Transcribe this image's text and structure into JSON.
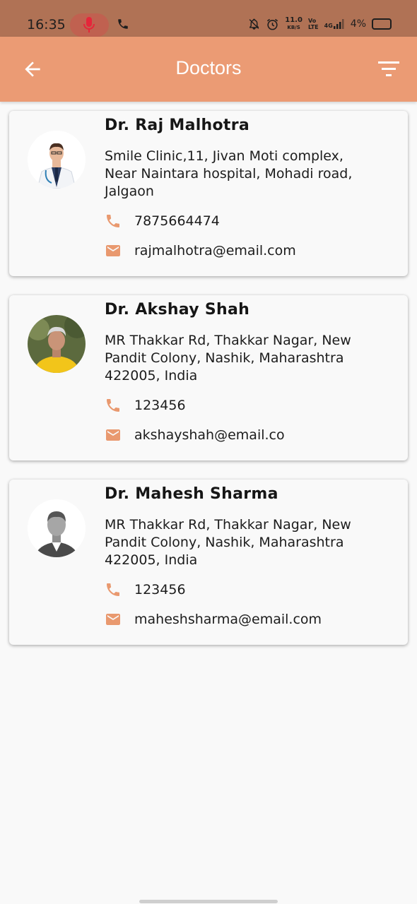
{
  "status_bar": {
    "time": "16:35",
    "net_speed_value": "11.0",
    "net_speed_unit": "KB/S",
    "volte_top": "Vo",
    "volte_bottom": "LTE",
    "network": "4G",
    "battery": "4%"
  },
  "app_bar": {
    "title": "Doctors",
    "back_icon": "arrow-left-icon",
    "filter_icon": "filter-icon"
  },
  "theme": {
    "accent": "#eb9b74",
    "status_bar": "#b07255",
    "icon_color": "#e9996f"
  },
  "doctors": [
    {
      "name": "Dr. Raj Malhotra",
      "address_lines": [
        "Smile Clinic,11, Jivan Moti complex,",
        "Near Naintara hospital, Mohadi road,",
        "Jalgaon"
      ],
      "phone": "7875664474",
      "email": "rajmalhotra@email.com"
    },
    {
      "name": "Dr. Akshay Shah",
      "address_lines": [
        "MR Thakkar Rd, Thakkar Nagar, New",
        "Pandit Colony, Nashik, Maharashtra",
        "422005, India"
      ],
      "phone": "123456",
      "email": "akshayshah@email.co"
    },
    {
      "name": "Dr. Mahesh Sharma",
      "address_lines": [
        "MR Thakkar Rd, Thakkar Nagar, New",
        "Pandit Colony, Nashik, Maharashtra",
        "422005, India"
      ],
      "phone": "123456",
      "email": "maheshsharma@email.com"
    }
  ]
}
